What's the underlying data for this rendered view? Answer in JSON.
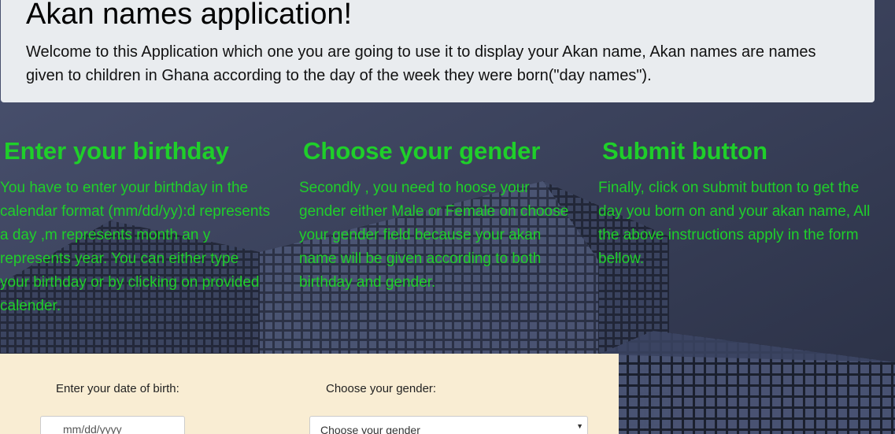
{
  "header": {
    "title": "Akan names application!",
    "intro": "Welcome to this Application which one you are going to use it to display your Akan name, Akan names are names given to children in Ghana according to the day of the week they were born(\"day names\")."
  },
  "instructions": [
    {
      "heading": "Enter your birthday",
      "text": "You have to enter your birthday in the calendar format (mm/dd/yy):d represents a day ,m represents month an y represents year. You can either type your birthday or by clicking on provided calender."
    },
    {
      "heading": "Choose your gender",
      "text": "Secondly , you need to hoose your gender either Male or Female on choose your gender field because your akan name will be given according to both birthday and gender."
    },
    {
      "heading": "Submit button",
      "text": "Finally, click on submit button to get the day you born on and your akan name, All the above instructions apply in the form bellow."
    }
  ],
  "form": {
    "dob_label": "Enter your date of birth:",
    "dob_placeholder": "mm/dd/yyyy",
    "gender_label": "Choose your gender:",
    "gender_selected": "Choose your gender",
    "dropdown_icon": "triangle-down-icon"
  },
  "colors": {
    "accent_green": "#1fcf2a",
    "form_background": "#f9edd3",
    "jumbotron_background": "#e9ecef"
  }
}
